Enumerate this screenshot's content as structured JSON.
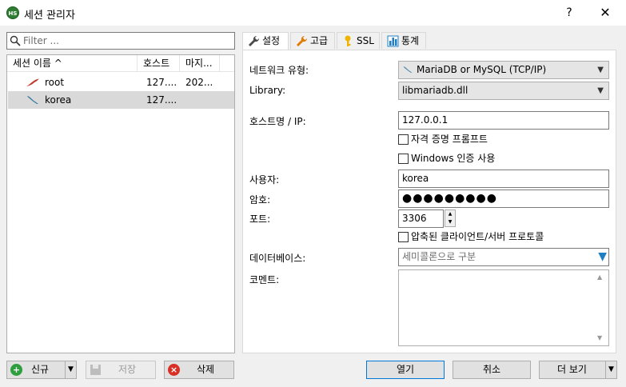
{
  "window": {
    "app_icon_text": "HS",
    "title": "세션 관리자",
    "help": "?",
    "close": "✕"
  },
  "filter": {
    "placeholder": "Filter ..."
  },
  "list": {
    "headers": {
      "name": "세션 이름 ^",
      "host": "호스트",
      "last": "마지..."
    },
    "rows": [
      {
        "name": "root",
        "host": "127....",
        "last": "202..."
      },
      {
        "name": "korea",
        "host": "127....",
        "last": ""
      }
    ]
  },
  "bottom_left": {
    "new_label": "신규",
    "save_label": "저장",
    "delete_label": "삭제"
  },
  "bottom_right": {
    "open_label": "열기",
    "cancel_label": "취소",
    "more_label": "더 보기"
  },
  "tabs": [
    {
      "label": "설정",
      "icon": "wrench-icon"
    },
    {
      "label": "고급",
      "icon": "wrench-orange-icon"
    },
    {
      "label": "SSL",
      "icon": "key-icon"
    },
    {
      "label": "통계",
      "icon": "bar-chart-icon"
    }
  ],
  "settings": {
    "network_type_label": "네트워크 유형:",
    "network_type_value": "MariaDB or MySQL (TCP/IP)",
    "library_label": "Library:",
    "library_value": "libmariadb.dll",
    "host_label": "호스트명 / IP:",
    "host_value": "127.0.0.1",
    "credential_prompt_label": "자격 증명 프롬프트",
    "windows_auth_label": "Windows 인증 사용",
    "user_label": "사용자:",
    "user_value": "korea",
    "password_label": "암호:",
    "password_value": "●●●●●●●●●",
    "port_label": "포트:",
    "port_value": "3306",
    "compressed_label": "압축된 클라이언트/서버 프로토콜",
    "database_label": "데이터베이스:",
    "database_placeholder": "세미콜론으로 구분",
    "comment_label": "코멘트:"
  },
  "colors": {
    "accent": "#0078d7",
    "selected_row": "#d9d9d9",
    "new_icon": "#2e9e3e",
    "delete_icon": "#d93025"
  }
}
